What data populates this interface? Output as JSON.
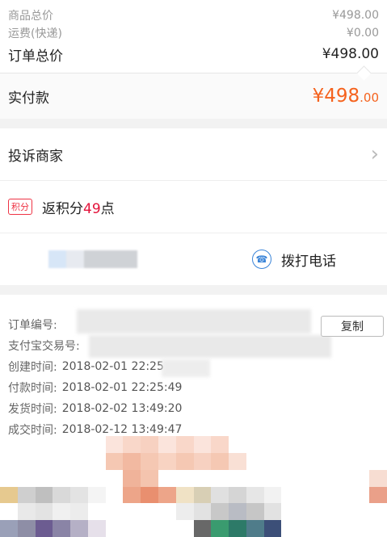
{
  "prices": {
    "goods_label": "商品总价",
    "goods_value": "¥498.00",
    "shipping_label": "运费(快递)",
    "shipping_value": "¥0.00",
    "order_label": "订单总价",
    "order_value": "¥498.00"
  },
  "paid": {
    "label": "实付款",
    "currency": "¥",
    "amount": "498",
    "cents": ".00"
  },
  "complaint": {
    "label": "投诉商家"
  },
  "points": {
    "badge": "积分",
    "prefix": "返积分",
    "number": "49",
    "suffix": "点"
  },
  "contact": {
    "call_label": "拨打电话"
  },
  "order_info": {
    "order_no_label": "订单编号:",
    "alipay_label": "支付宝交易号:",
    "created_label": "创建时间:",
    "created_value": "2018-02-01 22:25",
    "paid_label": "付款时间:",
    "paid_value": "2018-02-01 22:25:49",
    "shipped_label": "发货时间:",
    "shipped_value": "2018-02-02 13:49:20",
    "deal_label": "成交时间:",
    "deal_value": "2018-02-12 13:49:47",
    "copy_label": "复制"
  },
  "colors": {
    "accent": "#f5631e",
    "points_red": "#e3123a",
    "phone_blue": "#3a84d8"
  },
  "icons": {
    "chevron": "chevron-right-icon",
    "phone": "phone-icon"
  }
}
